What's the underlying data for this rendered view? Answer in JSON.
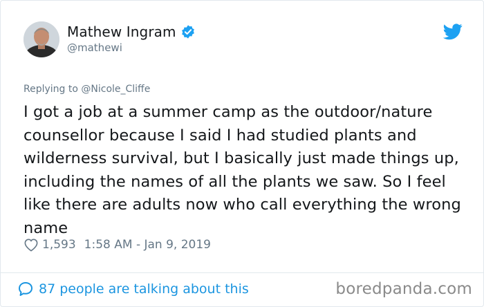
{
  "author": {
    "display_name": "Mathew Ingram",
    "handle": "@mathewi"
  },
  "icons": {
    "verified": "verified-badge-icon",
    "twitter": "twitter-bird-icon",
    "like": "heart-icon",
    "reply": "speech-bubble-icon"
  },
  "colors": {
    "accent": "#1da1f2",
    "link": "#1b95e0",
    "muted": "#657786"
  },
  "tweet": {
    "replying_to": "Replying to @Nicole_Cliffe",
    "text": "I got a job at a summer camp as the outdoor/nature counsellor because I said I had studied plants and wilderness survival, but I basically just made things up, including the names of all the plants we saw. So I feel like there are adults now who call everything the wrong name",
    "likes": "1,593",
    "timestamp": "1:58 AM - Jan 9, 2019"
  },
  "footer": {
    "talking": "87 people are talking about this",
    "watermark": "boredpanda.com"
  }
}
